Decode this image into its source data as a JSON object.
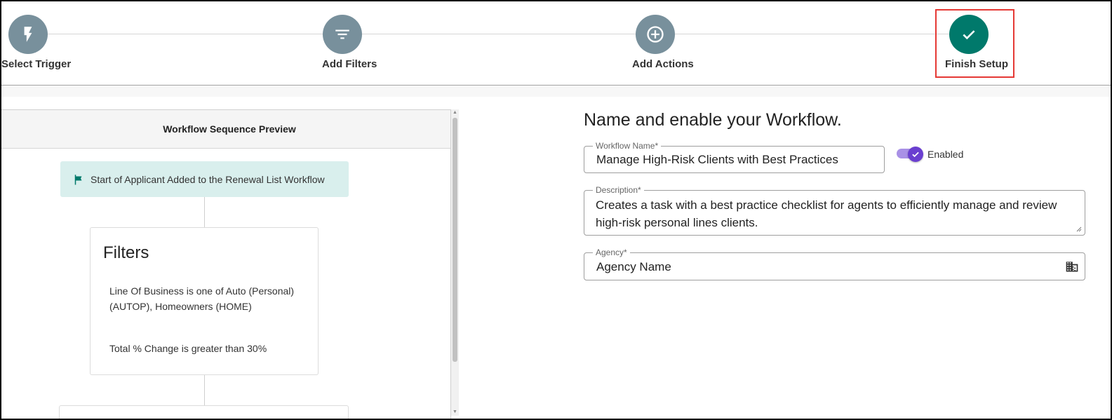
{
  "stepper": {
    "steps": [
      {
        "label": "Select Trigger",
        "icon": "lightning-icon",
        "state": "pending"
      },
      {
        "label": "Add Filters",
        "icon": "filter-icon",
        "state": "pending"
      },
      {
        "label": "Add Actions",
        "icon": "plus-circle-icon",
        "state": "pending"
      },
      {
        "label": "Finish Setup",
        "icon": "check-icon",
        "state": "complete"
      }
    ],
    "colors": {
      "pending": "#78909c",
      "complete": "#00796b",
      "highlight": "#e53935"
    }
  },
  "preview": {
    "header": "Workflow Sequence Preview",
    "start_node": "Start of Applicant Added to the Renewal List Workflow",
    "filters_card": {
      "title": "Filters",
      "conditions": [
        "Line Of Business is one of Auto (Personal) (AUTOP), Homeowners (HOME)",
        "Total % Change is greater than 30%"
      ]
    }
  },
  "form": {
    "title": "Name and enable your Workflow.",
    "workflow_name": {
      "label": "Workflow Name*",
      "value": "Manage High-Risk Clients with Best Practices"
    },
    "enabled": {
      "label": "Enabled",
      "value": true,
      "color": "#6a3fd0"
    },
    "description": {
      "label": "Description*",
      "value": "Creates a task with a best practice checklist for agents to efficiently manage and review high-risk personal lines clients."
    },
    "agency": {
      "label": "Agency*",
      "value": "Agency Name",
      "icon": "building-icon"
    }
  }
}
